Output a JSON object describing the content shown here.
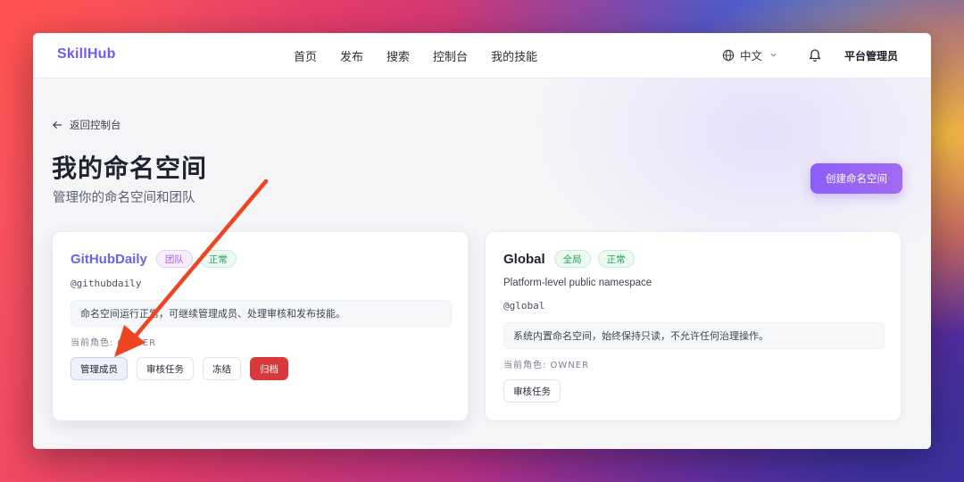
{
  "nav": {
    "brand": "SkillHub",
    "links": [
      "首页",
      "发布",
      "搜索",
      "控制台",
      "我的技能"
    ],
    "language": "中文",
    "user": "平台管理员",
    "icons": {
      "language": "globe-icon",
      "dropdown": "chevron-down-icon",
      "notifications": "bell-icon"
    }
  },
  "page": {
    "back_label": "返回控制台",
    "title": "我的命名空间",
    "subtitle": "管理你的命名空间和团队",
    "create_button": "创建命名空间"
  },
  "namespaces": [
    {
      "name": "GitHubDaily",
      "badges": [
        "团队",
        "正常"
      ],
      "slug": "@githubdaily",
      "notice": "命名空间运行正常，可继续管理成员、处理审核和发布技能。",
      "role": "当前角色: OWNER",
      "actions": [
        "管理成员",
        "审核任务",
        "冻结",
        "归档"
      ]
    },
    {
      "name": "Global",
      "badges": [
        "全局",
        "正常"
      ],
      "description": "Platform-level public namespace",
      "slug": "@global",
      "notice": "系统内置命名空间，始终保持只读，不允许任何治理操作。",
      "role": "当前角色: OWNER",
      "actions": [
        "审核任务"
      ]
    }
  ],
  "colors": {
    "brand": "#6d5cf0",
    "create_button": "#8a5ff7",
    "danger": "#d8393a",
    "annotation_arrow": "#ee4422"
  }
}
